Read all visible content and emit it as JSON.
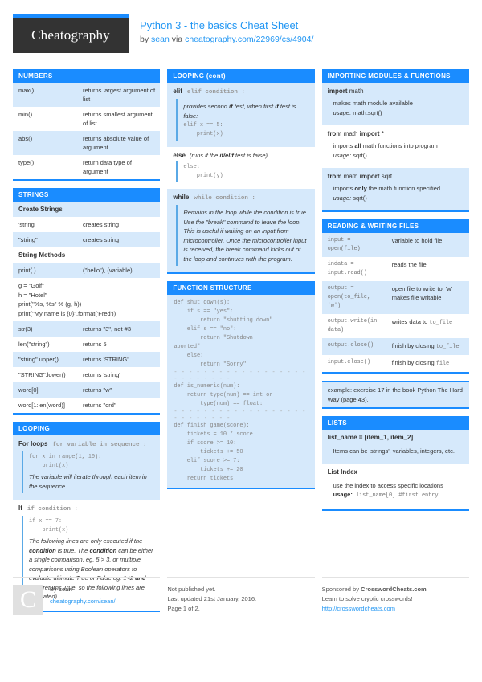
{
  "header": {
    "logo_text": "Cheatography",
    "title": "Python 3 - the basics Cheat Sheet",
    "by_prefix": "by ",
    "author": "sean",
    "via": " via ",
    "source_link": "cheatography.com/22969/cs/4904/"
  },
  "colors": {
    "accent": "#1a8cff",
    "alt_row": "#d6e9fb",
    "link": "#2196f3",
    "logo_bg": "#333333"
  },
  "numbers": {
    "title": "NUMBERS",
    "rows": [
      {
        "name": "max()",
        "desc": "returns largest argument of list"
      },
      {
        "name": "min()",
        "desc": "returns smallest argument of list"
      },
      {
        "name": "abs()",
        "desc": "returns absolute value of argument"
      },
      {
        "name": "type()",
        "desc": "return data type of argument"
      }
    ]
  },
  "strings": {
    "title": "STRINGS",
    "create_header": "Create Strings",
    "create_rows": [
      {
        "name": "'string'",
        "desc": "creates string"
      },
      {
        "name": "\"string\"",
        "desc": "creates string"
      }
    ],
    "methods_header": "String Methods",
    "print_row": {
      "name": "print( )",
      "desc": "(\"hello\"), (variable)"
    },
    "example_block": "g = \"Golf\"\nh = \"Hotel\"\nprint(\"%s, %s\" % (g, h))\nprint(\"My name is {0}\".format('Fred'))",
    "method_rows": [
      {
        "name": "str(3)",
        "desc": "returns \"3\", not #3"
      },
      {
        "name": "len(\"string\")",
        "desc": "returns 5"
      },
      {
        "name": "\"string\".upper()",
        "desc": "returns 'STRING'"
      },
      {
        "name": "\"STRING\".lower()",
        "desc": "returns 'string'"
      },
      {
        "name": "word[0]",
        "desc": "returns \"w\""
      },
      {
        "name": "word[1:len(word)]",
        "desc": "returns \"ord\""
      }
    ]
  },
  "looping": {
    "title": "LOOPING",
    "for_kw": "For loops",
    "for_sig": "for variable in sequence :",
    "for_code": "for x in range(1, 10):\n    print(x)",
    "for_desc": "The variable will iterate through each item in the sequence.",
    "if_kw": "If",
    "if_sig": "if condition :",
    "if_code": "if x == 7:\n    print(x)",
    "if_desc_1": "The following lines are only executed if the ",
    "if_desc_b1": "condition",
    "if_desc_2": " is true. The ",
    "if_desc_b2": "condition",
    "if_desc_3": " can be either a single comparison, eg. 5 > 3, or multiple comparisons using Boolean operators to evaluate ultimate True or False eg. 1<2 ",
    "if_desc_b3": "and",
    "if_desc_4": " 2<3 (returns True, so the following lines are evaluated)"
  },
  "looping_cont": {
    "title": "LOOPING (cont)",
    "elif_kw": "elif",
    "elif_sig": "elif condition :",
    "elif_desc_1": "provides second ",
    "elif_desc_b1": "if",
    "elif_desc_2": " test, when first ",
    "elif_desc_b2": "if",
    "elif_desc_3": " test is false:",
    "elif_code": "elif x == 5:\n    print(x)",
    "else_kw": "else",
    "else_note": "(runs if the ",
    "else_note_b": "if/elif",
    "else_note_2": " test is false)",
    "else_code": "else:\n    print(y)",
    "while_kw": "while",
    "while_sig": "while condition :",
    "while_desc": "Remains in the loop while the condition is true. Use the \"break\" command to leave the loop. This is useful if waiting on an input from microcontroller. Once the microcontroller input is received, the break command kicks out of the loop and continues with the program."
  },
  "function_structure": {
    "title": "FUNCTION STRUCTURE",
    "code_1": "def shut_down(s):\n    if s == \"yes\":\n        return \"shutting down\"\n    elif s == \"no\":\n        return \"Shutdown\naborted\"\n    else:\n        return \"Sorry\"",
    "divider": "- - - - - - - - - - - - - - - - - - - - - - - - - -",
    "code_2": "def is_numeric(num):\n    return type(num) == int or\n        type(num) == float:",
    "code_3": "def finish_game(score):\n    tickets = 10 * score\n    if score >= 10:\n        tickets += 50\n    elif score >= 7:\n        tickets += 20\n    return tickets"
  },
  "importing": {
    "title": "IMPORTING MODULES & FUNCTIONS",
    "items": [
      {
        "kw": "import",
        "rest": " math",
        "body_1": "makes math module available",
        "usage_label": "usage:",
        "usage": " math.sqrt()"
      },
      {
        "kw": "from",
        "rest": " math ",
        "kw2": "import",
        "rest2": " *",
        "body_pre": "imports ",
        "body_b": "all",
        "body_post": " math functions into program",
        "usage_label": "usage:",
        "usage": " sqrt()"
      },
      {
        "kw": "from",
        "rest": " math ",
        "kw2": "import",
        "rest2": " sqrt",
        "body_pre": "imports ",
        "body_b": "only",
        "body_post": " the math function specified",
        "usage_label": "usage:",
        "usage": " sqrt()"
      }
    ]
  },
  "files": {
    "title": "READING & WRITING FILES",
    "rows": [
      {
        "code": "input =\nopen(file)",
        "desc": "variable to hold file"
      },
      {
        "code": "indata =\ninput.read()",
        "desc": "reads the file"
      },
      {
        "code": "output =\nopen(to_file,\n'w')",
        "desc": "open file to write to, 'w' makes file writable"
      },
      {
        "code": "output.write(in\ndata)",
        "desc": "writes data to ",
        "desc_mono": "to_file"
      },
      {
        "code": "output.close()",
        "desc": "finish by closing ",
        "desc_mono": "to_file"
      },
      {
        "code": "input.close()",
        "desc": "finish by closing ",
        "desc_mono": "file"
      }
    ],
    "example_note": "example: exercise 17 in the book Python The Hard Way (page 43)."
  },
  "lists": {
    "title": "LISTS",
    "decl_header": "list_name = [item_1, item_2]",
    "decl_body": "Items can be 'strings', variables, integers, etc.",
    "index_header": "List Index",
    "index_body": "use the index to access specific locations",
    "index_usage_label": "usage:",
    "index_usage": " list_name[0] #first entry"
  },
  "footer": {
    "logo_letter": "C",
    "by_label": "By ",
    "author": "sean",
    "author_link": "cheatography.com/sean/",
    "published": "Not published yet.",
    "updated": "Last updated 21st January, 2016.",
    "page": "Page 1 of 2.",
    "sponsor_label": "Sponsored by ",
    "sponsor_name": "CrosswordCheats.com",
    "sponsor_tag": "Learn to solve cryptic crosswords!",
    "sponsor_link": "http://crosswordcheats.com"
  }
}
